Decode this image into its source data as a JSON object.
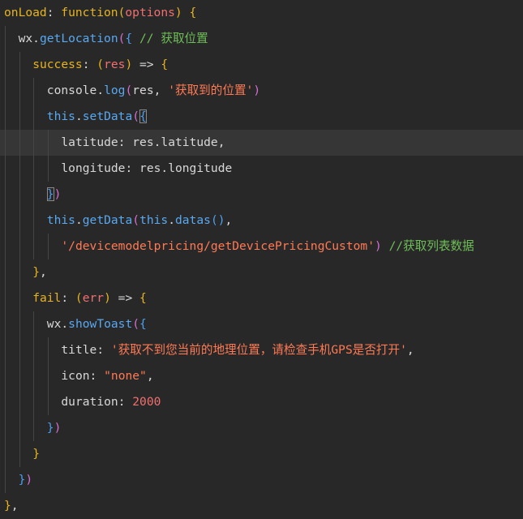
{
  "editor": {
    "current_line_index": 5,
    "lines": [
      {
        "indent": 0,
        "tokens": [
          {
            "t": "onLoad",
            "c": "t-prop"
          },
          {
            "t": ": ",
            "c": "t-plain"
          },
          {
            "t": "function",
            "c": "t-prop"
          },
          {
            "t": "(",
            "c": "t-br1"
          },
          {
            "t": "options",
            "c": "t-param"
          },
          {
            "t": ")",
            "c": "t-br1"
          },
          {
            "t": " {",
            "c": "t-br1"
          }
        ]
      },
      {
        "indent": 1,
        "tokens": [
          {
            "t": "wx",
            "c": "t-plain"
          },
          {
            "t": ".",
            "c": "t-plain"
          },
          {
            "t": "getLocation",
            "c": "t-kw"
          },
          {
            "t": "(",
            "c": "t-br2"
          },
          {
            "t": "{",
            "c": "t-br3"
          },
          {
            "t": " // 获取位置",
            "c": "t-cmt"
          }
        ]
      },
      {
        "indent": 2,
        "tokens": [
          {
            "t": "success",
            "c": "t-prop"
          },
          {
            "t": ": ",
            "c": "t-plain"
          },
          {
            "t": "(",
            "c": "t-br1"
          },
          {
            "t": "res",
            "c": "t-param"
          },
          {
            "t": ")",
            "c": "t-br1"
          },
          {
            "t": " => ",
            "c": "t-plain"
          },
          {
            "t": "{",
            "c": "t-br1"
          }
        ]
      },
      {
        "indent": 3,
        "tokens": [
          {
            "t": "console",
            "c": "t-plain"
          },
          {
            "t": ".",
            "c": "t-plain"
          },
          {
            "t": "log",
            "c": "t-kw"
          },
          {
            "t": "(",
            "c": "t-br2"
          },
          {
            "t": "res",
            "c": "t-plain"
          },
          {
            "t": ", ",
            "c": "t-plain"
          },
          {
            "t": "'获取到的位置'",
            "c": "t-str"
          },
          {
            "t": ")",
            "c": "t-br2"
          }
        ]
      },
      {
        "indent": 3,
        "tokens": [
          {
            "t": "this",
            "c": "t-kw"
          },
          {
            "t": ".",
            "c": "t-plain"
          },
          {
            "t": "setData",
            "c": "t-kw"
          },
          {
            "t": "(",
            "c": "t-br2"
          },
          {
            "t": "{",
            "c": "t-br3",
            "hl": true
          }
        ]
      },
      {
        "indent": 4,
        "tokens": [
          {
            "t": "latitude",
            "c": "t-plain"
          },
          {
            "t": ": ",
            "c": "t-plain"
          },
          {
            "t": "res",
            "c": "t-plain"
          },
          {
            "t": ".",
            "c": "t-plain"
          },
          {
            "t": "latitude",
            "c": "t-plain"
          },
          {
            "t": ",",
            "c": "t-plain"
          }
        ]
      },
      {
        "indent": 4,
        "tokens": [
          {
            "t": "longitude",
            "c": "t-plain"
          },
          {
            "t": ": ",
            "c": "t-plain"
          },
          {
            "t": "res",
            "c": "t-plain"
          },
          {
            "t": ".",
            "c": "t-plain"
          },
          {
            "t": "longitude",
            "c": "t-plain"
          }
        ]
      },
      {
        "indent": 3,
        "tokens": [
          {
            "t": "}",
            "c": "t-br3",
            "hl": true
          },
          {
            "t": ")",
            "c": "t-br2"
          }
        ]
      },
      {
        "indent": 3,
        "tokens": [
          {
            "t": "this",
            "c": "t-kw"
          },
          {
            "t": ".",
            "c": "t-plain"
          },
          {
            "t": "getData",
            "c": "t-kw"
          },
          {
            "t": "(",
            "c": "t-br2"
          },
          {
            "t": "this",
            "c": "t-kw"
          },
          {
            "t": ".",
            "c": "t-plain"
          },
          {
            "t": "datas",
            "c": "t-kw"
          },
          {
            "t": "()",
            "c": "t-br3"
          },
          {
            "t": ",",
            "c": "t-plain"
          }
        ]
      },
      {
        "indent": 4,
        "tokens": [
          {
            "t": "'/devicemodelpricing/getDevicePricingCustom'",
            "c": "t-str"
          },
          {
            "t": ")",
            "c": "t-br2"
          },
          {
            "t": " //获取列表数据",
            "c": "t-cmt"
          }
        ]
      },
      {
        "indent": 2,
        "tokens": [
          {
            "t": "}",
            "c": "t-br1"
          },
          {
            "t": ",",
            "c": "t-plain"
          }
        ]
      },
      {
        "indent": 2,
        "tokens": [
          {
            "t": "fail",
            "c": "t-prop"
          },
          {
            "t": ": ",
            "c": "t-plain"
          },
          {
            "t": "(",
            "c": "t-br1"
          },
          {
            "t": "err",
            "c": "t-param"
          },
          {
            "t": ")",
            "c": "t-br1"
          },
          {
            "t": " => ",
            "c": "t-plain"
          },
          {
            "t": "{",
            "c": "t-br1"
          }
        ]
      },
      {
        "indent": 3,
        "tokens": [
          {
            "t": "wx",
            "c": "t-plain"
          },
          {
            "t": ".",
            "c": "t-plain"
          },
          {
            "t": "showToast",
            "c": "t-kw"
          },
          {
            "t": "(",
            "c": "t-br2"
          },
          {
            "t": "{",
            "c": "t-br3"
          }
        ]
      },
      {
        "indent": 4,
        "tokens": [
          {
            "t": "title",
            "c": "t-plain"
          },
          {
            "t": ": ",
            "c": "t-plain"
          },
          {
            "t": "'获取不到您当前的地理位置，请检查手机GPS是否打开'",
            "c": "t-str"
          },
          {
            "t": ",",
            "c": "t-plain"
          }
        ]
      },
      {
        "indent": 4,
        "tokens": [
          {
            "t": "icon",
            "c": "t-plain"
          },
          {
            "t": ": ",
            "c": "t-plain"
          },
          {
            "t": "\"none\"",
            "c": "t-str"
          },
          {
            "t": ",",
            "c": "t-plain"
          }
        ]
      },
      {
        "indent": 4,
        "tokens": [
          {
            "t": "duration",
            "c": "t-plain"
          },
          {
            "t": ": ",
            "c": "t-plain"
          },
          {
            "t": "2000",
            "c": "t-num"
          }
        ]
      },
      {
        "indent": 3,
        "tokens": [
          {
            "t": "}",
            "c": "t-br3"
          },
          {
            "t": ")",
            "c": "t-br2"
          }
        ]
      },
      {
        "indent": 2,
        "tokens": [
          {
            "t": "}",
            "c": "t-br1"
          }
        ]
      },
      {
        "indent": 1,
        "tokens": [
          {
            "t": "}",
            "c": "t-br3"
          },
          {
            "t": ")",
            "c": "t-br2"
          }
        ]
      },
      {
        "indent": 0,
        "tokens": [
          {
            "t": "}",
            "c": "t-br1"
          },
          {
            "t": ",",
            "c": "t-plain"
          }
        ]
      }
    ]
  }
}
